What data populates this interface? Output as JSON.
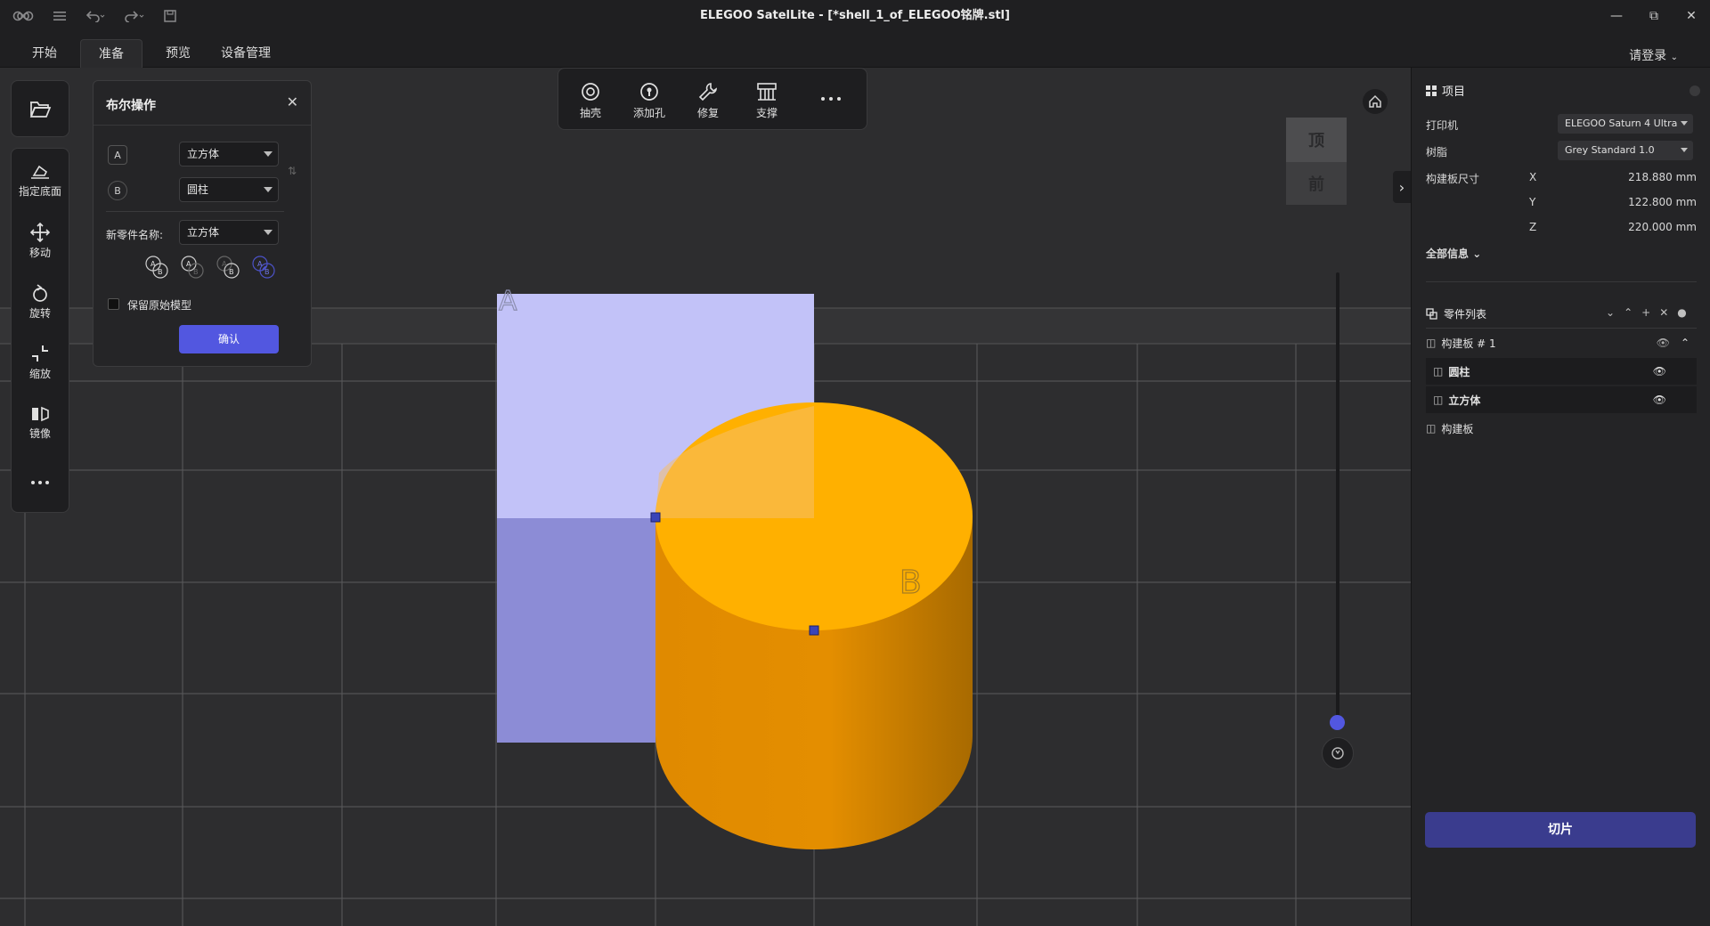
{
  "window": {
    "title": "ELEGOO SatelLite - [*shell_1_of_ELEGOO铭牌.stl]"
  },
  "menu": {
    "tabs": [
      "开始",
      "准备",
      "预览",
      "设备管理"
    ],
    "active_tab": "准备",
    "login_label": "请登录"
  },
  "left_toolbar": {
    "items": [
      "指定底面",
      "移动",
      "旋转",
      "缩放",
      "镜像"
    ]
  },
  "bool_panel": {
    "title": "布尔操作",
    "a_badge": "A",
    "b_badge": "B",
    "a_value": "立方体",
    "b_value": "圆柱",
    "new_name_label": "新零件名称:",
    "new_name_value": "立方体",
    "keep_original_label": "保留原始模型",
    "keep_original_checked": false,
    "confirm_label": "确认"
  },
  "top_toolbar": {
    "items": [
      "抽壳",
      "添加孔",
      "修复",
      "支撑"
    ]
  },
  "view_cube": {
    "top_label": "顶",
    "front_label": "前"
  },
  "scene": {
    "label_a": "A",
    "label_b": "B",
    "colors": {
      "cube_top": "#c2c2f8",
      "cube_side": "#8c8cd6",
      "cylinder_top": "#ffb000",
      "cylinder_side": "#e08a00"
    }
  },
  "right_panel": {
    "project_title": "项目",
    "printer_label": "打印机",
    "printer_value": "ELEGOO Saturn 4 Ultra",
    "resin_label": "树脂",
    "resin_value": "Grey Standard 1.0",
    "plate_size_label": "构建板尺寸",
    "dims": [
      {
        "axis": "X",
        "value": "218.880 mm"
      },
      {
        "axis": "Y",
        "value": "122.800 mm"
      },
      {
        "axis": "Z",
        "value": "220.000 mm"
      }
    ],
    "all_info_label": "全部信息",
    "parts_title": "零件列表",
    "plate_group": "构建板 # 1",
    "parts": [
      "圆柱",
      "立方体"
    ],
    "plate_label": "构建板",
    "slice_label": "切片"
  }
}
